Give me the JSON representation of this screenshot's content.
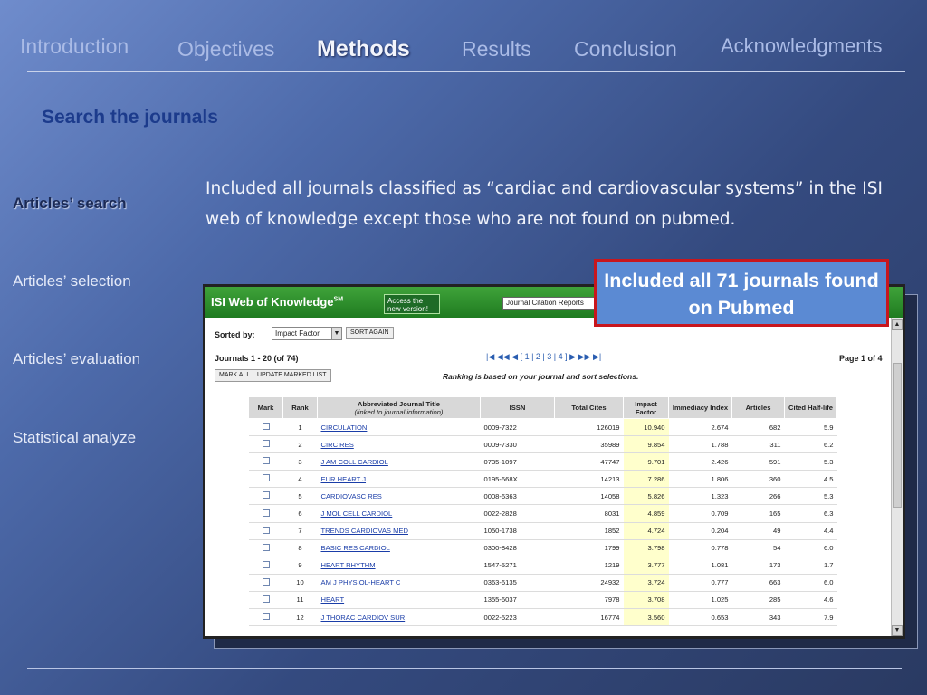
{
  "nav": {
    "introduction": "Introduction",
    "objectives": "Objectives",
    "methods": "Methods",
    "results": "Results",
    "conclusion": "Conclusion",
    "acknowledgments": "Acknowledgments"
  },
  "section_title": "Search the journals",
  "sidebar": {
    "items": [
      "Articles’ search",
      "Articles’ selection",
      "Articles’ evaluation",
      "Statistical analyze"
    ]
  },
  "description": "Included all journals classified as “cardiac and cardiovascular systems” in the ISI web of knowledge except those who are not found on pubmed.",
  "callout": "Included all 71 journals found on Pubmed",
  "isi": {
    "logo": "ISI Web of Knowledge",
    "logo_sup": "SM",
    "access_button": "Access the new version!",
    "product_select": "Journal Citation Reports",
    "sorted_by_label": "Sorted by:",
    "sort_value": "Impact Factor",
    "sort_again": "SORT AGAIN",
    "journals_range": "Journals 1 - 20 (of 74)",
    "pager": "[ 1 | 2 | 3 | 4 ]",
    "page_of": "Page 1 of 4",
    "mark_all": "MARK ALL",
    "update_marked": "UPDATE MARKED LIST",
    "ranking_note": "Ranking is based on your journal and sort selections.",
    "columns": {
      "mark": "Mark",
      "rank": "Rank",
      "title": "Abbreviated Journal Title",
      "title_sub": "(linked to journal information)",
      "issn": "ISSN",
      "total_cites": "Total Cites",
      "impact_factor": "Impact Factor",
      "immediacy": "Immediacy Index",
      "articles": "Articles",
      "half_life": "Cited Half-life"
    },
    "rows": [
      {
        "rank": "1",
        "title": "CIRCULATION",
        "issn": "0009-7322",
        "cites": "126019",
        "if": "10.940",
        "imm": "2.674",
        "articles": "682",
        "hl": "5.9"
      },
      {
        "rank": "2",
        "title": "CIRC RES",
        "issn": "0009-7330",
        "cites": "35989",
        "if": "9.854",
        "imm": "1.788",
        "articles": "311",
        "hl": "6.2"
      },
      {
        "rank": "3",
        "title": "J AM COLL CARDIOL",
        "issn": "0735-1097",
        "cites": "47747",
        "if": "9.701",
        "imm": "2.426",
        "articles": "591",
        "hl": "5.3"
      },
      {
        "rank": "4",
        "title": "EUR HEART J",
        "issn": "0195-668X",
        "cites": "14213",
        "if": "7.286",
        "imm": "1.806",
        "articles": "360",
        "hl": "4.5"
      },
      {
        "rank": "5",
        "title": "CARDIOVASC RES",
        "issn": "0008-6363",
        "cites": "14058",
        "if": "5.826",
        "imm": "1.323",
        "articles": "266",
        "hl": "5.3"
      },
      {
        "rank": "6",
        "title": "J MOL CELL CARDIOL",
        "issn": "0022-2828",
        "cites": "8031",
        "if": "4.859",
        "imm": "0.709",
        "articles": "165",
        "hl": "6.3"
      },
      {
        "rank": "7",
        "title": "TRENDS CARDIOVAS MED",
        "issn": "1050-1738",
        "cites": "1852",
        "if": "4.724",
        "imm": "0.204",
        "articles": "49",
        "hl": "4.4"
      },
      {
        "rank": "8",
        "title": "BASIC RES CARDIOL",
        "issn": "0300-8428",
        "cites": "1799",
        "if": "3.798",
        "imm": "0.778",
        "articles": "54",
        "hl": "6.0"
      },
      {
        "rank": "9",
        "title": "HEART RHYTHM",
        "issn": "1547-5271",
        "cites": "1219",
        "if": "3.777",
        "imm": "1.081",
        "articles": "173",
        "hl": "1.7"
      },
      {
        "rank": "10",
        "title": "AM J PHYSIOL-HEART C",
        "issn": "0363-6135",
        "cites": "24932",
        "if": "3.724",
        "imm": "0.777",
        "articles": "663",
        "hl": "6.0"
      },
      {
        "rank": "11",
        "title": "HEART",
        "issn": "1355-6037",
        "cites": "7978",
        "if": "3.708",
        "imm": "1.025",
        "articles": "285",
        "hl": "4.6"
      },
      {
        "rank": "12",
        "title": "J THORAC CARDIOV SUR",
        "issn": "0022-5223",
        "cites": "16774",
        "if": "3.560",
        "imm": "0.653",
        "articles": "343",
        "hl": "7.9"
      }
    ]
  }
}
